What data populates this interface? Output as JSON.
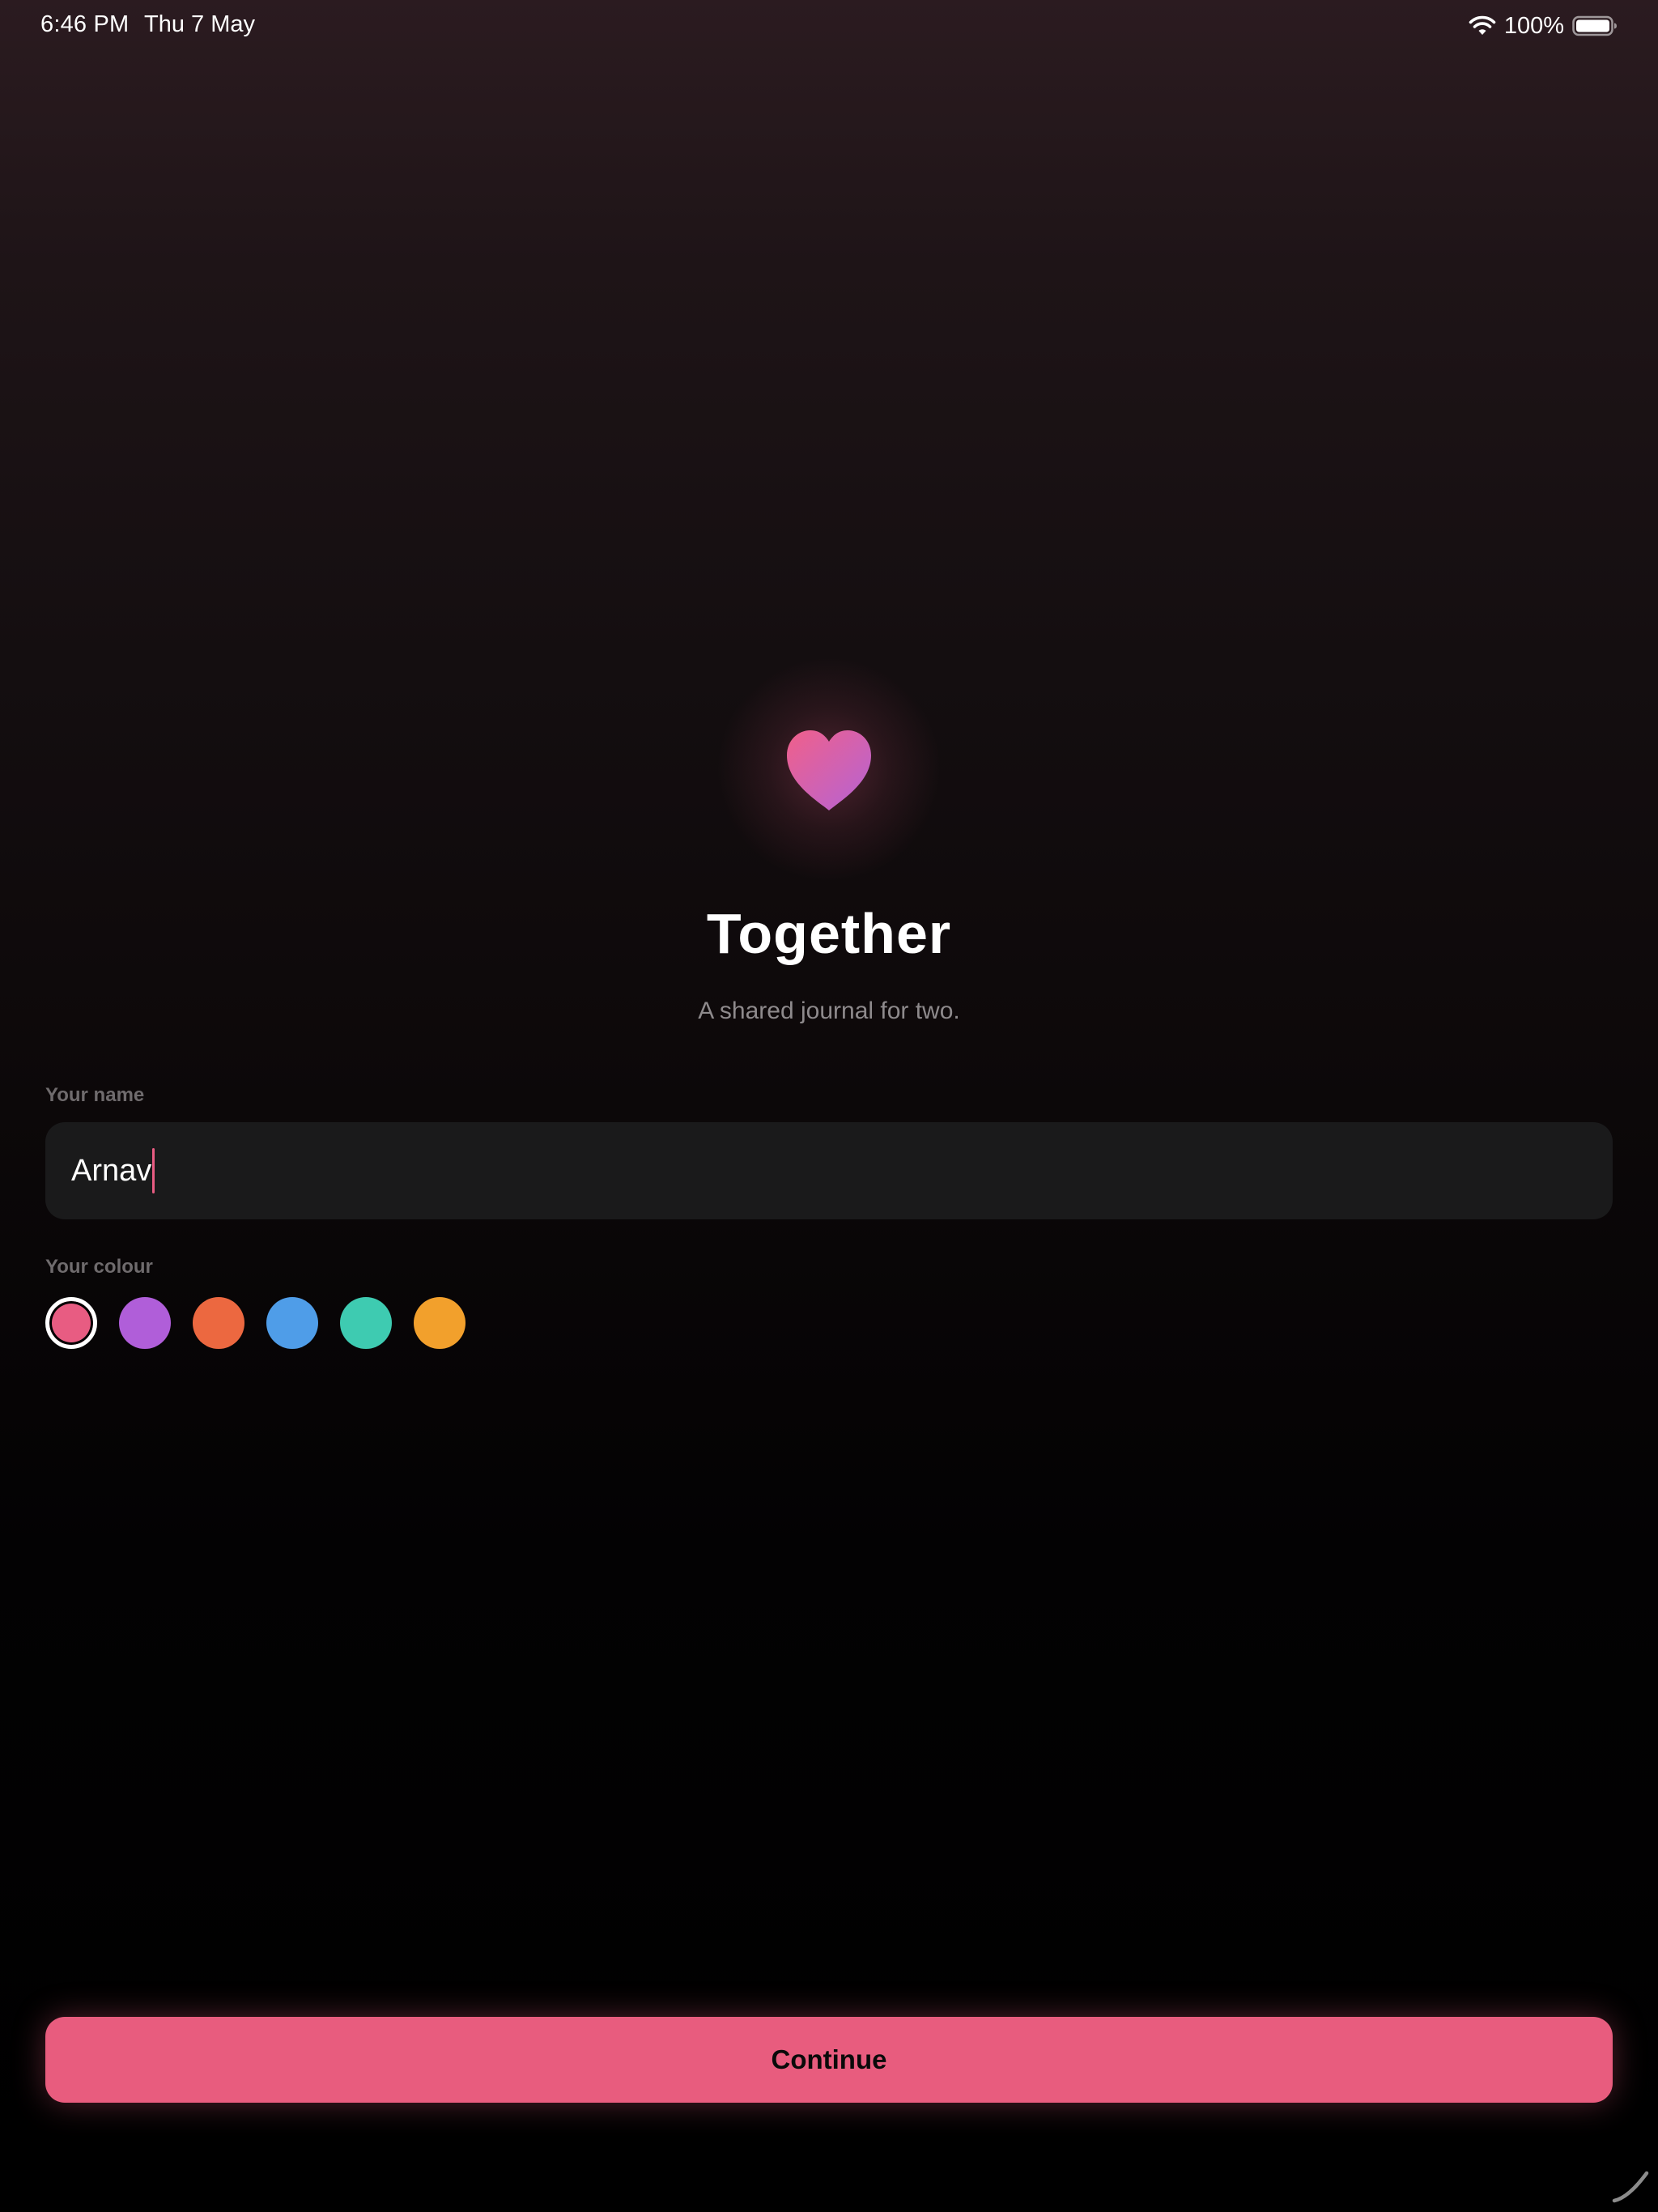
{
  "status_bar": {
    "time": "6:46 PM",
    "date": "Thu 7 May",
    "battery_percent": "100%",
    "wifi_icon": "wifi-icon",
    "battery_icon": "battery-full-icon"
  },
  "hero": {
    "icon": "heart-icon",
    "title": "Together",
    "subtitle": "A shared journal for two."
  },
  "name_field": {
    "label": "Your name",
    "value": "Arnav"
  },
  "colour_picker": {
    "label": "Your colour",
    "selected_index": 0,
    "swatches": [
      {
        "color": "#e85c82"
      },
      {
        "color": "#b05ed9"
      },
      {
        "color": "#ec6840"
      },
      {
        "color": "#4f9de8"
      },
      {
        "color": "#3ecbb1"
      },
      {
        "color": "#f2a02c"
      }
    ]
  },
  "continue_button": {
    "label": "Continue",
    "color": "#e85c7e"
  },
  "theme": {
    "accent": "#e85c82",
    "background": "#000000",
    "field_background": "#1a1a1b",
    "muted_text": "#8e8a8c"
  }
}
